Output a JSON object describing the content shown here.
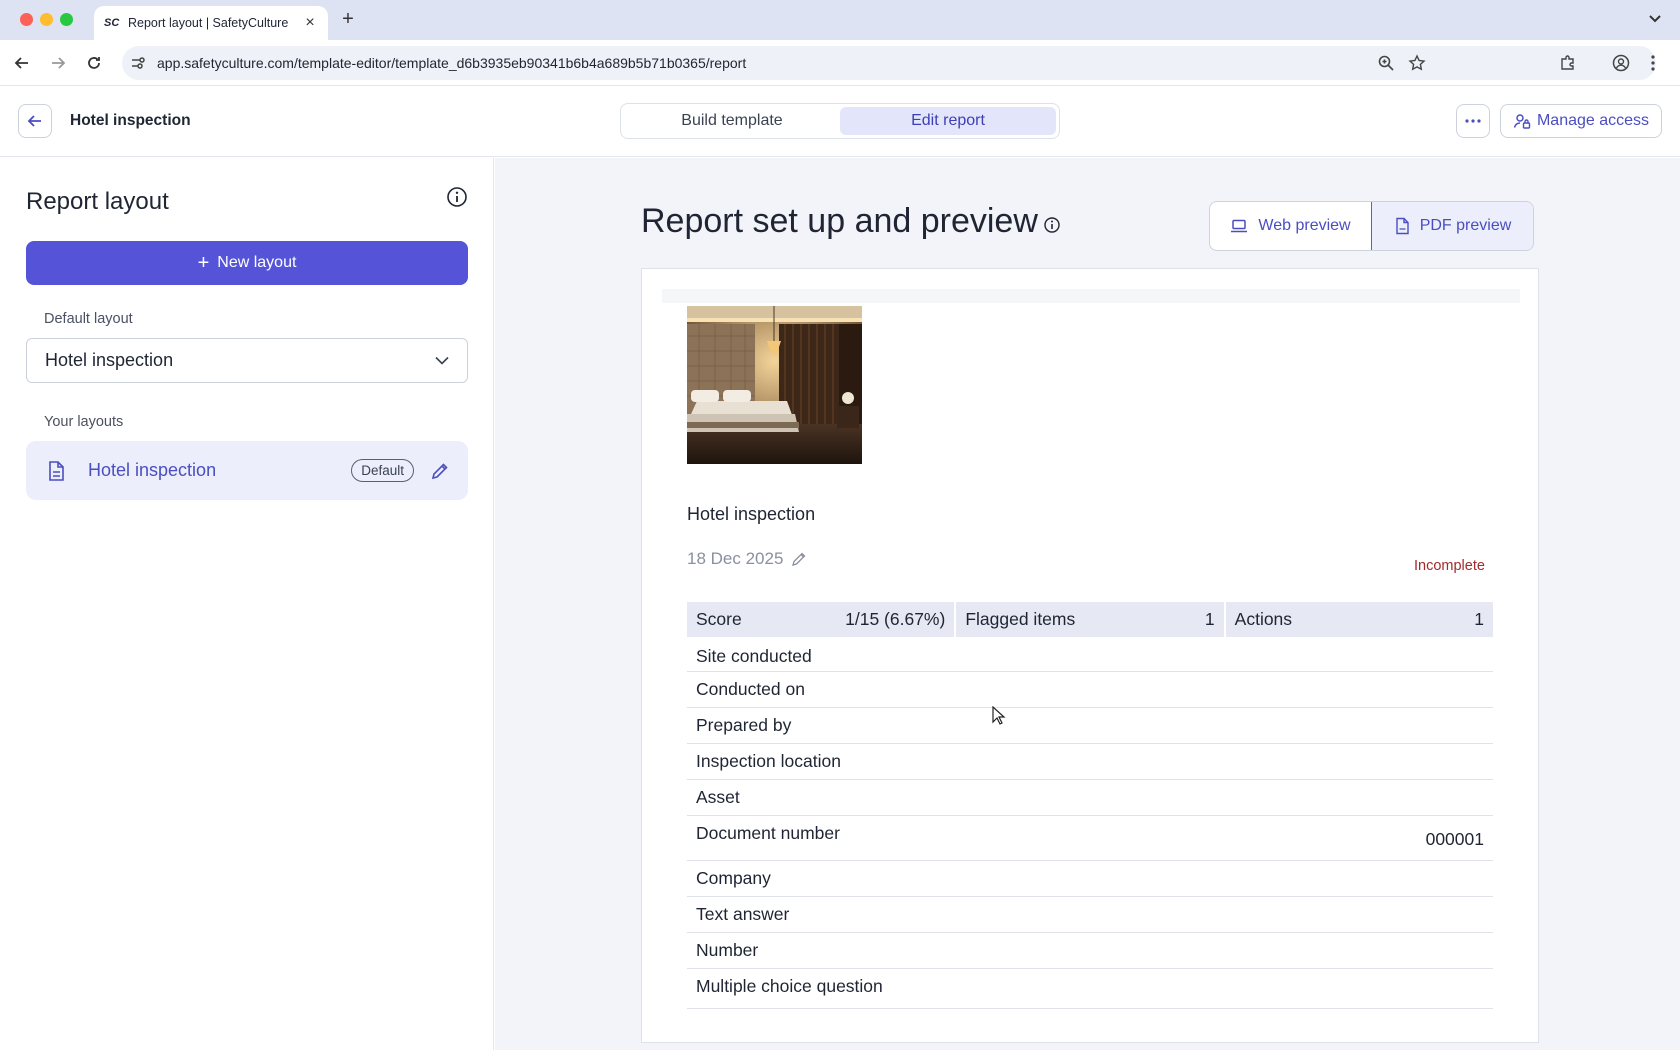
{
  "browser": {
    "tab_title": "Report layout | SafetyCulture",
    "tab_favicon": "SC",
    "url": "app.safetyculture.com/template-editor/template_d6b3935eb90341b6b4a689b5b71b0365/report"
  },
  "header": {
    "title": "Hotel inspection",
    "tabs": [
      {
        "label": "Build template",
        "active": false
      },
      {
        "label": "Edit report",
        "active": true
      }
    ],
    "manage_access_label": "Manage access"
  },
  "sidebar": {
    "title": "Report layout",
    "new_layout_label": "New layout",
    "default_layout_label": "Default layout",
    "default_layout_value": "Hotel inspection",
    "your_layouts_label": "Your layouts",
    "layouts": [
      {
        "name": "Hotel inspection",
        "badge": "Default"
      }
    ]
  },
  "main": {
    "title": "Report set up and preview",
    "web_preview_label": "Web preview",
    "pdf_preview_label": "PDF preview",
    "report": {
      "title": "Hotel inspection",
      "date": "18 Dec 2025",
      "status": "Incomplete",
      "summary": [
        {
          "label": "Score",
          "value": "1/15 (6.67%)"
        },
        {
          "label": "Flagged items",
          "value": "1"
        },
        {
          "label": "Actions",
          "value": "1"
        }
      ],
      "fields": [
        {
          "label": "Site conducted",
          "value": ""
        },
        {
          "label": "Conducted on",
          "value": ""
        },
        {
          "label": "Prepared by",
          "value": ""
        },
        {
          "label": "Inspection location",
          "value": ""
        },
        {
          "label": "Asset",
          "value": ""
        },
        {
          "label": "Document number",
          "value": "000001"
        },
        {
          "label": "Company",
          "value": ""
        },
        {
          "label": "Text answer",
          "value": ""
        },
        {
          "label": "Number",
          "value": ""
        },
        {
          "label": "Multiple choice question",
          "value": ""
        }
      ]
    }
  },
  "colors": {
    "accent": "#5554d9",
    "accent_text": "#4a4ec0",
    "status_incomplete": "#a32b2b"
  }
}
